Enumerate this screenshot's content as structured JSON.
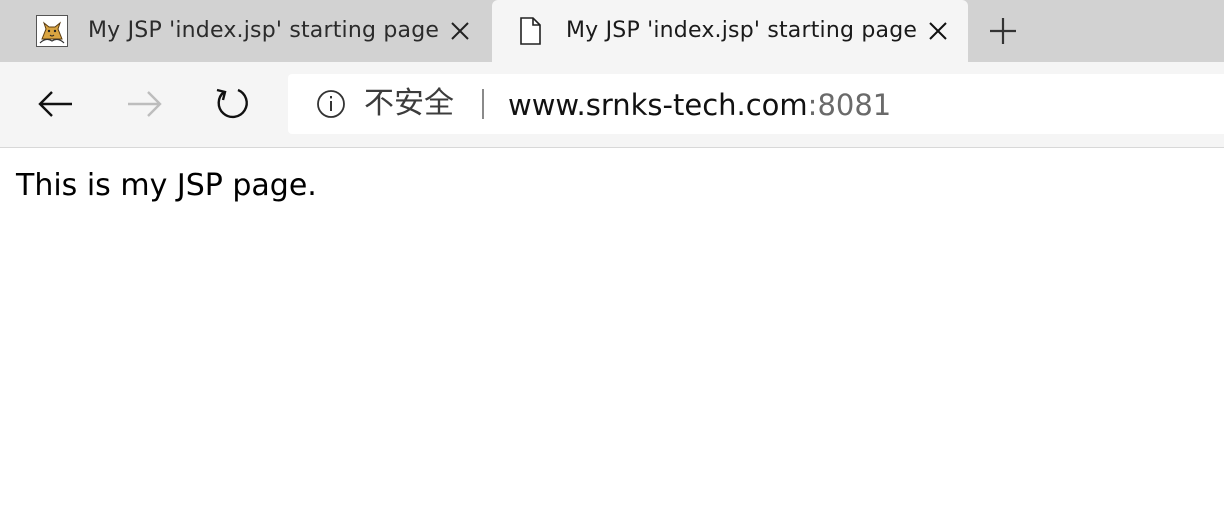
{
  "tabs": [
    {
      "title": "My JSP 'index.jsp' starting page",
      "favicon": "tomcat-icon",
      "active": false
    },
    {
      "title": "My JSP 'index.jsp' starting page",
      "favicon": "page-icon",
      "active": true
    }
  ],
  "toolbar": {
    "back_icon": "back-arrow-icon",
    "forward_icon": "forward-arrow-icon",
    "refresh_icon": "refresh-icon"
  },
  "address_bar": {
    "security_icon": "info-icon",
    "security_label": "不安全",
    "url_host": "www.srnks-tech.com",
    "url_port": ":8081"
  },
  "page": {
    "body_text": "This is my JSP page."
  },
  "colors": {
    "tabstrip_bg": "#d2d2d2",
    "active_tab_bg": "#f5f5f5",
    "content_bg": "#ffffff"
  }
}
